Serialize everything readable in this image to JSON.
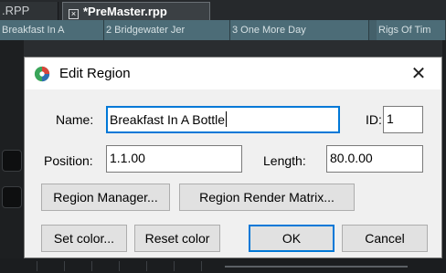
{
  "project_tabs": [
    {
      "label": ".RPP"
    },
    {
      "label": "*PreMaster.rpp"
    }
  ],
  "regions": [
    {
      "label": "Breakfast In A"
    },
    {
      "label": "2  Bridgewater Jer"
    },
    {
      "label": "3  One More Day"
    },
    {
      "label": "Rigs Of Tim"
    }
  ],
  "dialog": {
    "title": "Edit Region",
    "close_glyph": "✕",
    "name_label": "Name:",
    "name_value": "Breakfast In A Bottle",
    "id_label": "ID:",
    "id_value": "1",
    "position_label": "Position:",
    "position_value": "1.1.00",
    "length_label": "Length:",
    "length_value": "80.0.00",
    "region_manager_label": "Region Manager...",
    "render_matrix_label": "Region Render Matrix...",
    "set_color_label": "Set color...",
    "reset_color_label": "Reset color",
    "ok_label": "OK",
    "cancel_label": "Cancel"
  },
  "colors": {
    "accent_focus": "#0078d7",
    "region_bar": "#44606a",
    "app_icon_red": "#d9453b",
    "app_icon_green": "#3aa55a",
    "app_icon_blue": "#2f6fb3"
  },
  "icons": {
    "app": "reaper-logo-icon",
    "tab_close": "close-box-icon",
    "dialog_close": "close-icon"
  }
}
